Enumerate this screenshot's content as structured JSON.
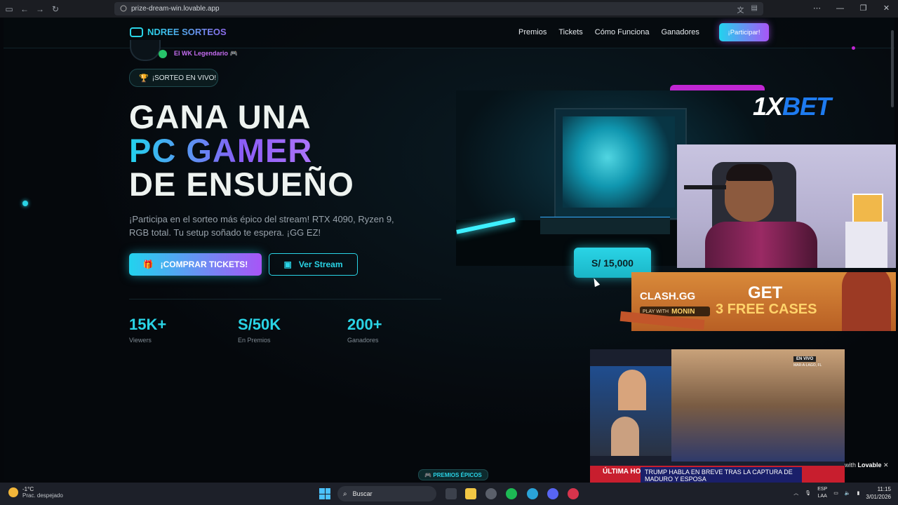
{
  "browser": {
    "url": "prize-dream-win.lovable.app"
  },
  "nav": {
    "brand": "NDREE SORTEOS",
    "items": [
      "Premios",
      "Tickets",
      "Cómo Funciona",
      "Ganadores"
    ],
    "cta": "¡Participar!"
  },
  "streamer": {
    "name": "El WK Legendario 🎮"
  },
  "badge": "¡SORTEO EN VIVO!",
  "hero": {
    "line1": "GANA UNA",
    "line2": "PC GAMER",
    "line3": "DE ENSUEÑO",
    "description": "¡Participa en el sorteo más épico del stream! RTX 4090, Ryzen 9, RGB total. Tu setup soñado te espera. ¡GG EZ!",
    "buy_button": "¡COMPRAR TICKETS!",
    "watch_button": "Ver Stream"
  },
  "stats": [
    {
      "value": "15K+",
      "label": "Viewers"
    },
    {
      "value": "S/50K",
      "label": "En Premios"
    },
    {
      "value": "200+",
      "label": "Ganadores"
    }
  ],
  "prize": {
    "price": "S/ 15,000"
  },
  "premios_pill": "🎮 PREMIOS ÉPICOS",
  "overlays": {
    "bet_logo_1x": "1X",
    "bet_logo_bet": "BET",
    "clash_logo": "CLASH.GG",
    "clash_play_with": "PLAY WITH",
    "clash_monin": "MONIN",
    "clash_get": "GET",
    "clash_free": "3 FREE CASES",
    "news_live": "EN VIVO",
    "news_place": "MAR-A-LAGO, FL",
    "news_label": "ÚLTIMA HORA",
    "news_headline": "TRUMP HABLA EN BREVE TRAS LA CAPTURA DE MADURO Y ESPOSA",
    "lovable_prefix": "with",
    "lovable_name": "Lovable"
  },
  "taskbar": {
    "temp": "-1°C",
    "weather": "Prac. despejado",
    "search": "Buscar",
    "lang": "ESP",
    "region": "LAA",
    "time": "11:15",
    "date": "3/01/2026"
  },
  "colors": {
    "accent_cyan": "#2ad4e6",
    "accent_purple": "#a855f7"
  }
}
